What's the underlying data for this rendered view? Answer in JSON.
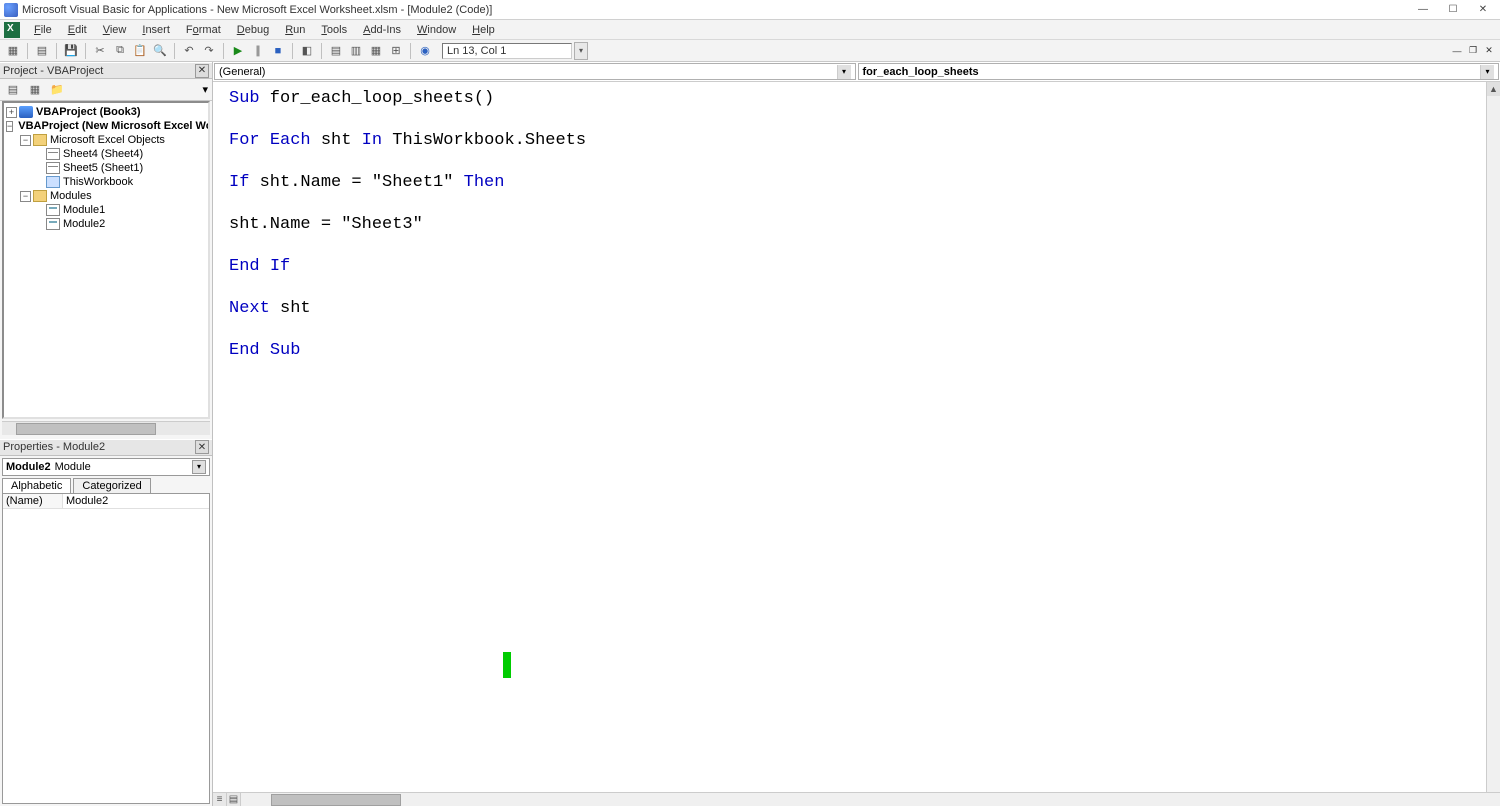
{
  "title": "Microsoft Visual Basic for Applications - New Microsoft Excel Worksheet.xlsm - [Module2 (Code)]",
  "menus": {
    "file": "File",
    "edit": "Edit",
    "view": "View",
    "insert": "Insert",
    "format": "Format",
    "debug": "Debug",
    "run": "Run",
    "tools": "Tools",
    "addins": "Add-Ins",
    "window": "Window",
    "help": "Help"
  },
  "statusbar": {
    "line_col": "Ln 13, Col 1"
  },
  "project_panel": {
    "title": "Project - VBAProject",
    "nodes": {
      "proj1": "VBAProject (Book3)",
      "proj2": "VBAProject (New Microsoft Excel Worksl",
      "excel_objs": "Microsoft Excel Objects",
      "sheet4": "Sheet4 (Sheet4)",
      "sheet5": "Sheet5 (Sheet1)",
      "thiswb": "ThisWorkbook",
      "modules": "Modules",
      "module1": "Module1",
      "module2": "Module2"
    }
  },
  "properties_panel": {
    "title": "Properties - Module2",
    "object_name": "Module2",
    "object_type": "Module",
    "tabs": {
      "alpha": "Alphabetic",
      "cat": "Categorized"
    },
    "rows": {
      "name_key": "(Name)",
      "name_val": "Module2"
    }
  },
  "code_combos": {
    "left": "(General)",
    "right": "for_each_loop_sheets"
  },
  "code": {
    "l1a": "Sub",
    "l1b": " for_each_loop_sheets()",
    "blank": "",
    "l2a": "For",
    "l2b": " ",
    "l2c": "Each",
    "l2d": " sht ",
    "l2e": "In",
    "l2f": " ThisWorkbook.Sheets",
    "l3a": "If",
    "l3b": " sht.Name = \"Sheet1\" ",
    "l3c": "Then",
    "l4": "sht.Name = \"Sheet3\"",
    "l5a": "End",
    "l5b": " ",
    "l5c": "If",
    "l6a": "Next",
    "l6b": " sht",
    "l7a": "End",
    "l7b": " ",
    "l7c": "Sub"
  }
}
